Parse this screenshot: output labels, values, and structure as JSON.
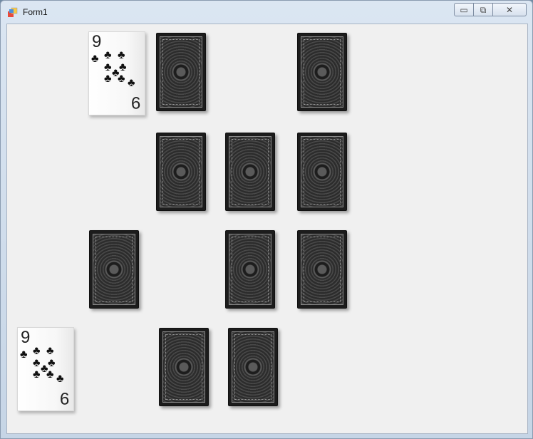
{
  "window": {
    "title": "Form1",
    "minimize_glyph": "▭",
    "maximize_glyph": "⧉",
    "close_glyph": "✕"
  },
  "cards": {
    "face_rank": "9",
    "face_rank_inverted": "9",
    "pip": "♣"
  }
}
